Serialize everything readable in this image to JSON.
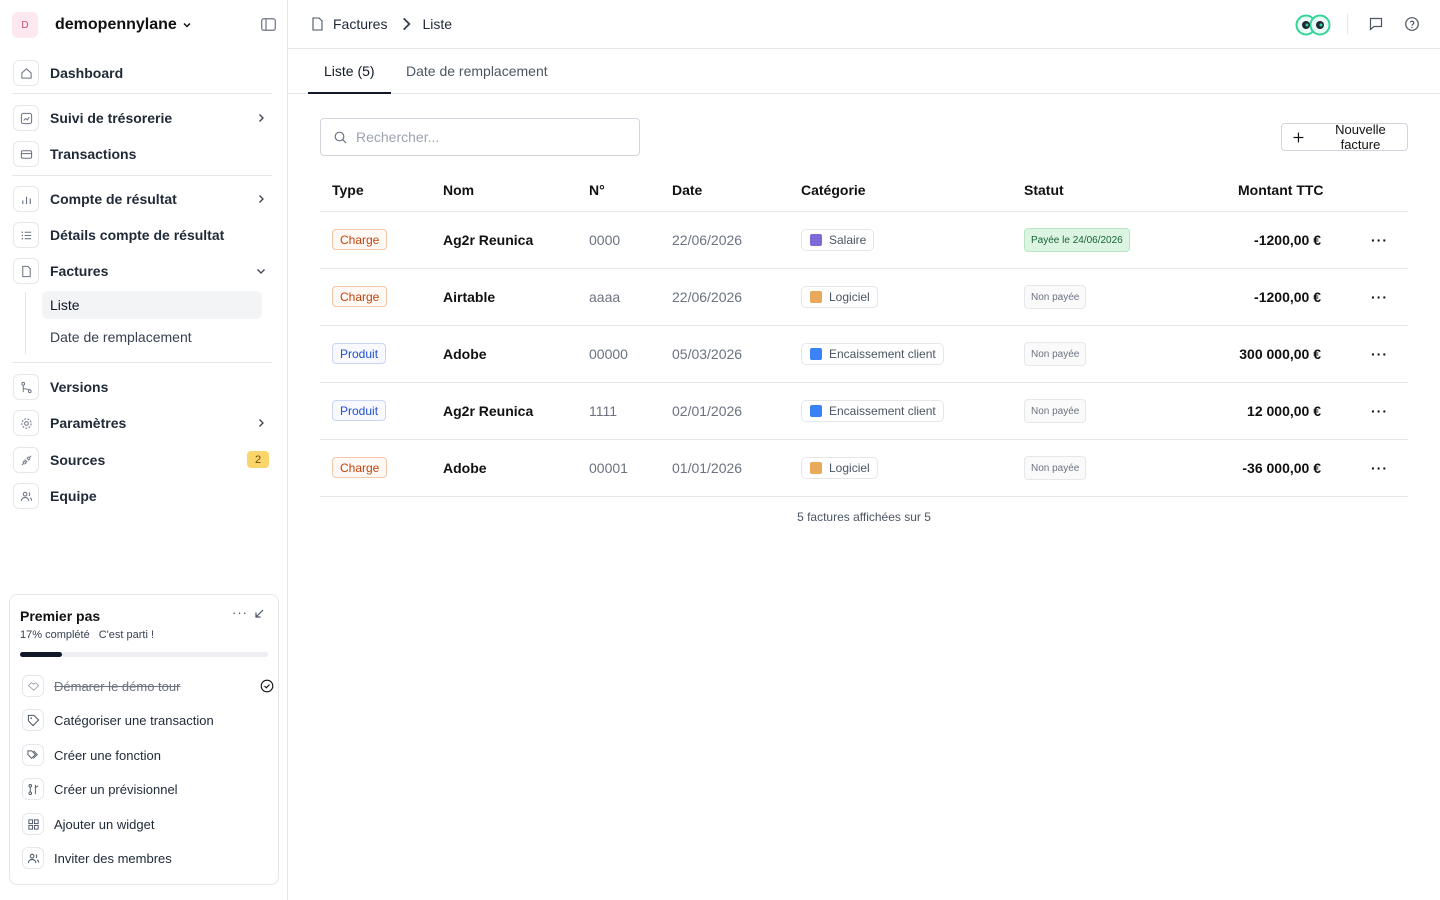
{
  "workspace": {
    "initial": "D",
    "name": "demopennylane"
  },
  "nav": {
    "dashboard": "Dashboard",
    "tresorerie": "Suivi de trésorerie",
    "transactions": "Transactions",
    "compte_resultat": "Compte de résultat",
    "details_compte": "Détails compte de résultat",
    "factures": "Factures",
    "liste": "Liste",
    "date_remplacement": "Date de remplacement",
    "versions": "Versions",
    "parametres": "Paramètres",
    "sources": "Sources",
    "sources_count": "2",
    "equipe": "Equipe"
  },
  "onboarding": {
    "title": "Premier pas",
    "progress_text": "17% complété",
    "progress_msg": "C'est parti !",
    "progress_value": 0.17,
    "items": [
      {
        "label": "Démarer le démo tour",
        "done": true
      },
      {
        "label": "Catégoriser une transaction",
        "done": false
      },
      {
        "label": "Créer une fonction",
        "done": false
      },
      {
        "label": "Créer un prévisionnel",
        "done": false
      },
      {
        "label": "Ajouter un widget",
        "done": false
      },
      {
        "label": "Inviter des membres",
        "done": false
      }
    ]
  },
  "breadcrumb": {
    "section": "Factures",
    "page": "Liste"
  },
  "tabs": {
    "liste": "Liste (5)",
    "date": "Date de remplacement"
  },
  "search": {
    "placeholder": "Rechercher..."
  },
  "new_invoice": "Nouvelle facture",
  "table": {
    "headers": {
      "type": "Type",
      "nom": "Nom",
      "numero": "N°",
      "date": "Date",
      "categorie": "Catégorie",
      "statut": "Statut",
      "montant": "Montant TTC"
    },
    "rows": [
      {
        "type": "Charge",
        "kind": "charge",
        "nom": "Ag2r Reunica",
        "numero": "0000",
        "date": "22/06/2026",
        "categorie": "Salaire",
        "cat_color": "#7c6ad6",
        "statut": "Payée le 24/06/2026",
        "paid": true,
        "montant": "-1200,00 €"
      },
      {
        "type": "Charge",
        "kind": "charge",
        "nom": "Airtable",
        "numero": "aaaa",
        "date": "22/06/2026",
        "categorie": "Logiciel",
        "cat_color": "#e8a95b",
        "statut": "Non payée",
        "paid": false,
        "montant": "-1200,00 €"
      },
      {
        "type": "Produit",
        "kind": "produit",
        "nom": "Adobe",
        "numero": "00000",
        "date": "05/03/2026",
        "categorie": "Encaissement client",
        "cat_color": "#3b82f6",
        "statut": "Non payée",
        "paid": false,
        "montant": "300 000,00 €"
      },
      {
        "type": "Produit",
        "kind": "produit",
        "nom": "Ag2r Reunica",
        "numero": "1111",
        "date": "02/01/2026",
        "categorie": "Encaissement client",
        "cat_color": "#3b82f6",
        "statut": "Non payée",
        "paid": false,
        "montant": "12 000,00 €"
      },
      {
        "type": "Charge",
        "kind": "charge",
        "nom": "Adobe",
        "numero": "00001",
        "date": "01/01/2026",
        "categorie": "Logiciel",
        "cat_color": "#e8a95b",
        "statut": "Non payée",
        "paid": false,
        "montant": "-36 000,00 €"
      }
    ]
  },
  "footer": "5 factures affichées sur 5",
  "colors": {
    "accent": "#111827",
    "border": "#e5e7eb",
    "badge_yellow": "#fcd56a"
  }
}
